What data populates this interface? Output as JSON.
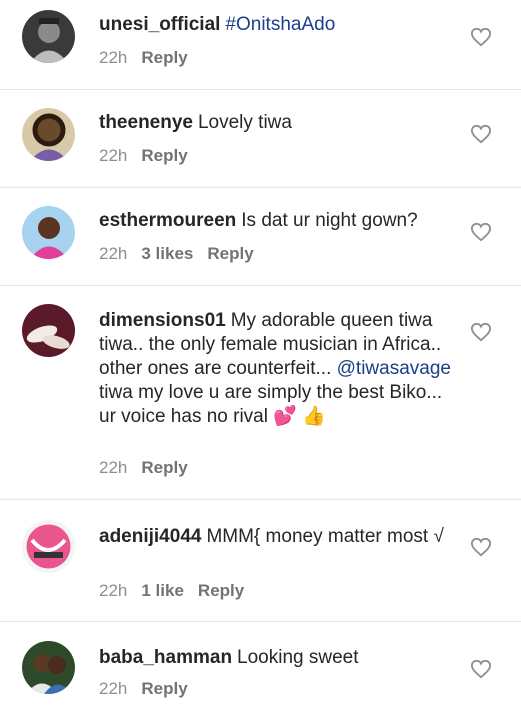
{
  "comments": [
    {
      "username": "unesi_official",
      "text_parts": [
        {
          "type": "hashtag",
          "text": "#OnitshaAdo"
        }
      ],
      "time": "22h",
      "likes": "",
      "reply_label": "Reply",
      "avatar": "avatar-man-black-white"
    },
    {
      "username": "theenenye",
      "text_parts": [
        {
          "type": "text",
          "text": "Lovely tiwa"
        }
      ],
      "time": "22h",
      "likes": "",
      "reply_label": "Reply",
      "avatar": "avatar-woman-portrait"
    },
    {
      "username": "esthermoureen",
      "text_parts": [
        {
          "type": "text",
          "text": "Is dat ur night gown?"
        }
      ],
      "time": "22h",
      "likes": "3 likes",
      "reply_label": "Reply",
      "avatar": "avatar-woman-pink"
    },
    {
      "username": "dimensions01",
      "text_parts": [
        {
          "type": "text",
          "text": "My adorable queen tiwa tiwa.. the only female musician in Africa.. other ones are counterfeit... "
        },
        {
          "type": "mention",
          "text": "@tiwasavage"
        },
        {
          "type": "text",
          "text": " tiwa my love u are simply the best Biko... ur voice has no rival "
        },
        {
          "type": "emoji",
          "text": "💕"
        },
        {
          "type": "text",
          "text": " "
        },
        {
          "type": "emoji",
          "text": "👍"
        }
      ],
      "time": "22h",
      "likes": "",
      "reply_label": "Reply",
      "avatar": "avatar-shoes"
    },
    {
      "username": "adeniji4044",
      "text_parts": [
        {
          "type": "text",
          "text": "MMM{ money matter most √"
        }
      ],
      "time": "22h",
      "likes": "1 like",
      "reply_label": "Reply",
      "avatar": "avatar-pink-graphic"
    },
    {
      "username": "baba_hamman",
      "text_parts": [
        {
          "type": "text",
          "text": "Looking sweet"
        }
      ],
      "time": "22h",
      "likes": "",
      "reply_label": "Reply",
      "avatar": "avatar-couple"
    }
  ],
  "colors": {
    "link": "#1c3f87",
    "meta": "#8e8e8e",
    "divider": "#e6e6e6"
  }
}
